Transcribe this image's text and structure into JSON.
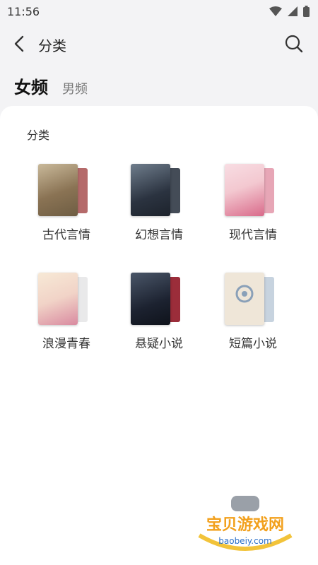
{
  "status_bar": {
    "time": "11:56"
  },
  "header": {
    "title": "分类"
  },
  "gender_tabs": {
    "female": "女频",
    "male": "男频"
  },
  "section": {
    "title": "分类"
  },
  "categories": [
    {
      "label": "古代言情",
      "colors": [
        "#c9b99a",
        "#6e5d43",
        "#b56a6a"
      ]
    },
    {
      "label": "幻想言情",
      "colors": [
        "#2b3340",
        "#6f7d8c",
        "#444c57"
      ]
    },
    {
      "label": "现代言情",
      "colors": [
        "#f3c8d0",
        "#d96a8a",
        "#e7a6b6"
      ]
    },
    {
      "label": "浪漫青春",
      "colors": [
        "#f7e9d6",
        "#d98aa0",
        "#e9e9ea"
      ]
    },
    {
      "label": "悬疑小说",
      "colors": [
        "#1c2230",
        "#4a5668",
        "#9b2d3a"
      ]
    },
    {
      "label": "短篇小说",
      "colors": [
        "#efe6d8",
        "#8aa0b8",
        "#e2dccf"
      ]
    }
  ],
  "watermark": {
    "name": "宝贝游戏网",
    "url": "baobeiy.com"
  }
}
